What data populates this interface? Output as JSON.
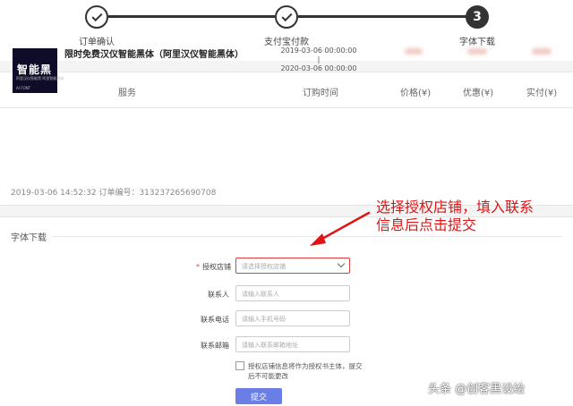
{
  "steps": [
    {
      "label": "订单确认",
      "state": "done"
    },
    {
      "label": "支付宝付款",
      "state": "done"
    },
    {
      "label": "字体下载",
      "state": "active",
      "number": "3"
    }
  ],
  "order": {
    "headers": {
      "service": "服务",
      "time": "订购时间",
      "price": "价格(¥)",
      "discount": "优惠(¥)",
      "paid": "实付(¥)"
    },
    "product": {
      "thumb_title": "智能黑",
      "thumb_subtitle": "阿里汉仪智能黑 阿里智能黑体",
      "thumb_brand": "AI FONT",
      "name": "限时免费汉仪智能黑体（阿里汉仪智能黑体）",
      "start": "2019-03-06 00:00:00",
      "separator": "|",
      "end": "2020-03-06 00:00:00"
    },
    "meta": "2019-03-06 14:52:32    订单编号：313237265690708"
  },
  "download": {
    "title": "字体下载",
    "store": {
      "label": "授权店铺",
      "required": "*",
      "placeholder": "请选择授权店铺"
    },
    "contact": {
      "label": "联系人",
      "placeholder": "请输入联系人"
    },
    "phone": {
      "label": "联系电话",
      "placeholder": "请输入手机号码"
    },
    "email": {
      "label": "联系邮箱",
      "placeholder": "请输入联系邮箱地址"
    },
    "notice": "授权店铺信息将作为授权书主体，提交后不可能更改",
    "submit": "提交"
  },
  "annotation": {
    "line1": "选择授权店铺，填入联系",
    "line2": "信息后点击提交",
    "color": "#e01414"
  },
  "watermark": "头条 @创客黑设绘"
}
